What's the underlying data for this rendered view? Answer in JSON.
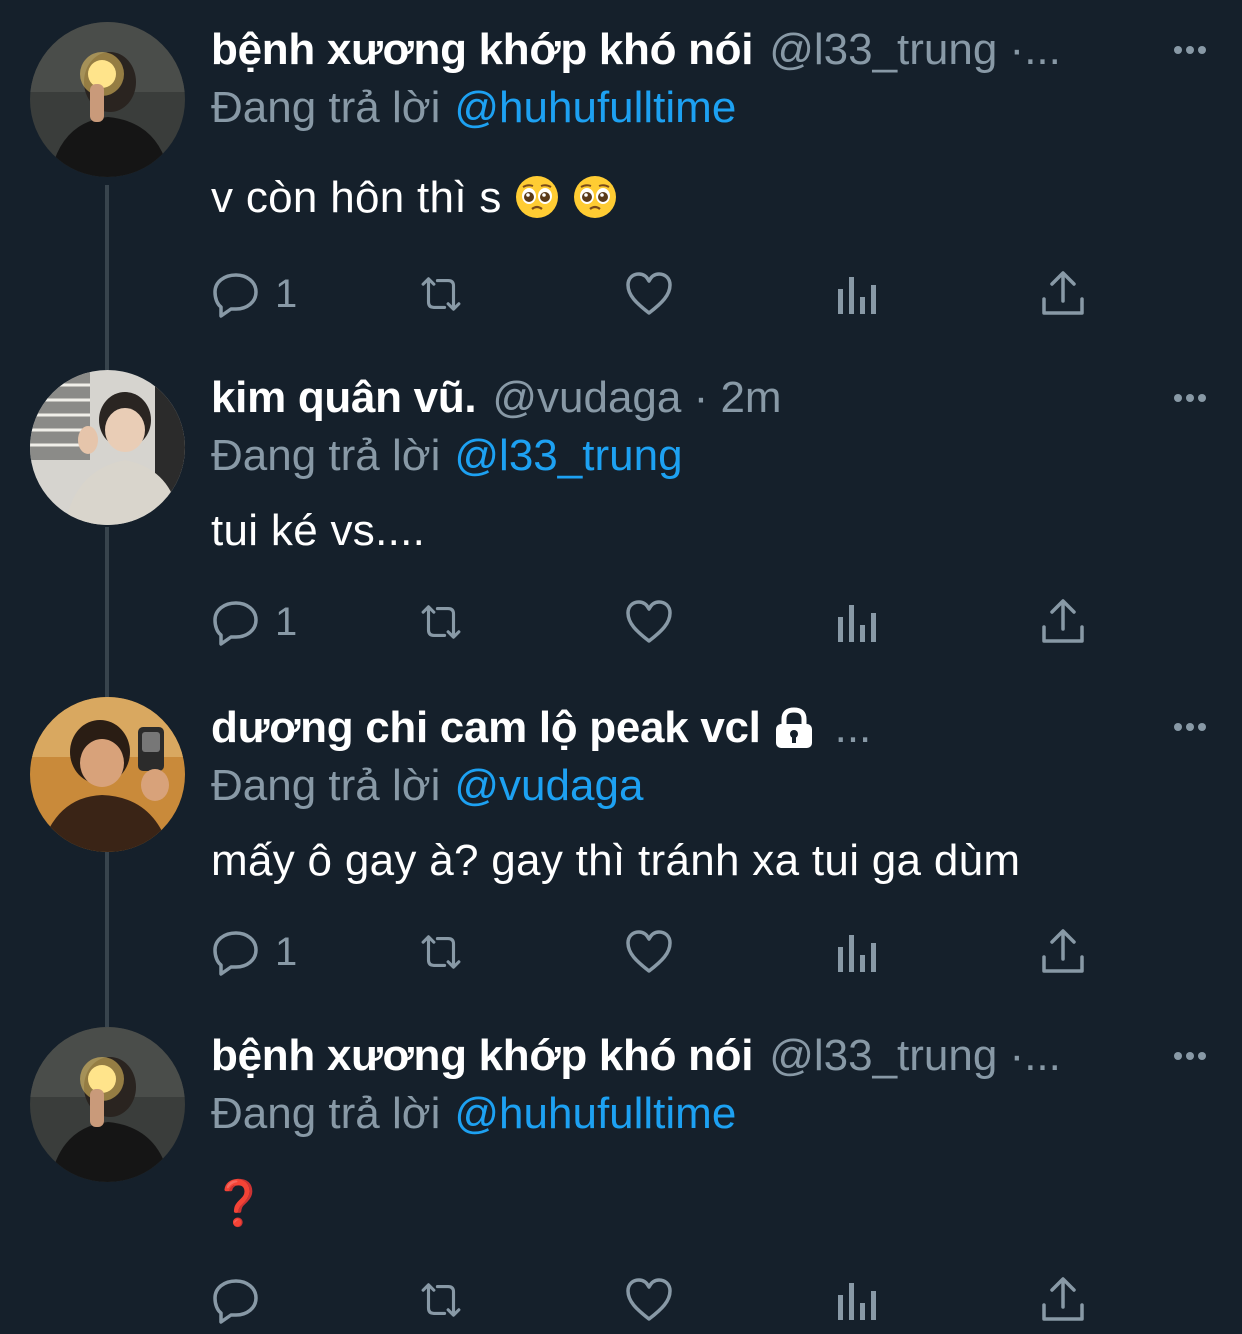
{
  "tweets": [
    {
      "name": "bệnh xương khớp khó nói",
      "handle": "@l33_trung ·...",
      "reply_prefix": "Đang trả lời",
      "reply_to": "@huhufulltime",
      "text": "v còn hôn thì s",
      "emojis": [
        "pleading-face",
        "pleading-face"
      ],
      "reply_count": "1"
    },
    {
      "name": "kim quân vũ.",
      "handle": "@vudaga · 2m",
      "reply_prefix": "Đang trả lời",
      "reply_to": "@l33_trung",
      "text": "tui ké vs....",
      "reply_count": "1"
    },
    {
      "name": "dương chi cam lộ peak vcl",
      "handle": "...",
      "locked": true,
      "reply_prefix": "Đang trả lời",
      "reply_to": "@vudaga",
      "text": "mấy ô gay à? gay thì tránh xa tui ga dùm",
      "reply_count": "1"
    },
    {
      "name": "bệnh xương khớp khó nói",
      "handle": "@l33_trung ·...",
      "reply_prefix": "Đang trả lời",
      "reply_to": "@huhufulltime",
      "text": "❓",
      "reply_count": ""
    }
  ],
  "icons": {
    "reply": "reply-icon",
    "retweet": "retweet-icon",
    "like": "heart-icon",
    "analytics": "analytics-icon",
    "share": "share-icon",
    "more": "more-dots-icon",
    "lock": "lock-icon"
  },
  "colors": {
    "background": "#15202b",
    "secondary_text": "#8899a6",
    "link": "#1da1f2",
    "thread_line": "#38444d",
    "question_mark": "#e0142a"
  }
}
